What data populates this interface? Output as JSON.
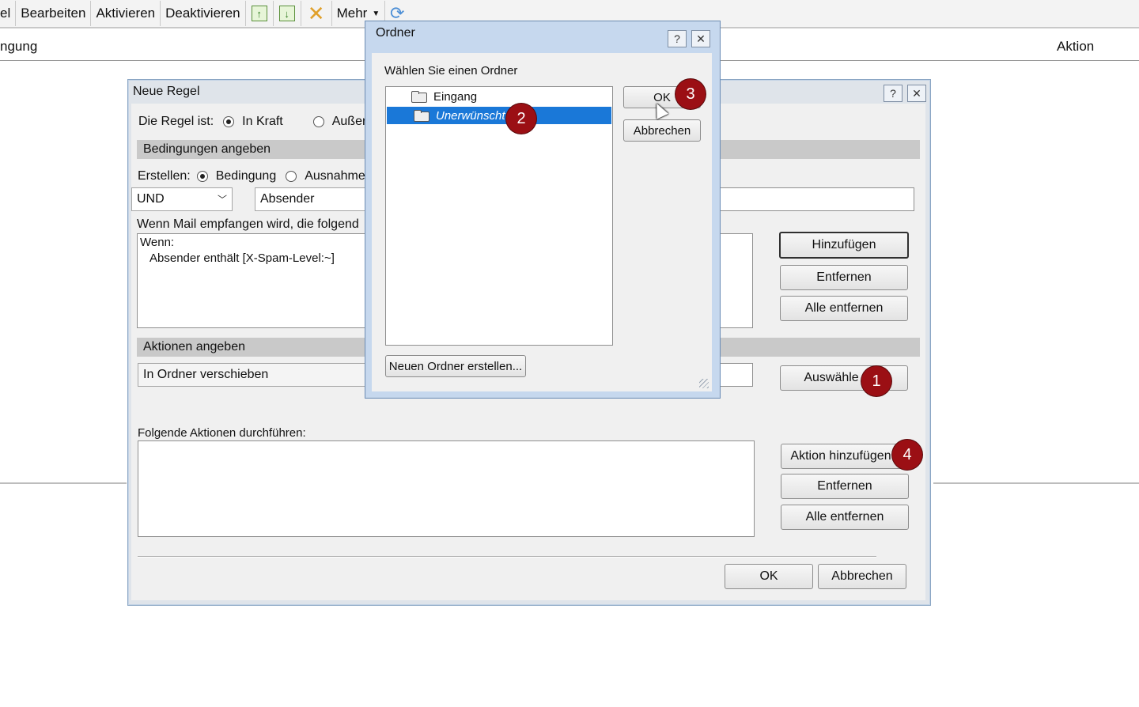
{
  "toolbar": {
    "items": [
      "el",
      "Bearbeiten",
      "Aktivieren",
      "Deaktivieren"
    ],
    "mehr": "Mehr"
  },
  "columns": {
    "left": "ngung",
    "right": "Aktion"
  },
  "rule_dialog": {
    "title": "Neue Regel",
    "rule_is_label": "Die Regel ist:",
    "in_force": "In Kraft",
    "out_of_force": "Außer",
    "conditions_header": "Bedingungen angeben",
    "create_label": "Erstellen:",
    "condition": "Bedingung",
    "exception": "Ausnahme",
    "operator_value": "UND",
    "field_value": "Absender",
    "when_received": "Wenn Mail empfangen wird, die folgend",
    "conditions_text_line1": "Wenn:",
    "conditions_text_line2": "Absender enthält [X-Spam-Level:~]",
    "btn_add": "Hinzufügen",
    "btn_remove": "Entfernen",
    "btn_remove_all": "Alle entfernen",
    "actions_header": "Aktionen angeben",
    "action_value": "In Ordner verschieben",
    "btn_select": "Auswähle",
    "perform_label": "Folgende Aktionen durchführen:",
    "btn_add_action": "Aktion hinzufügen",
    "btn_remove2": "Entfernen",
    "btn_remove_all2": "Alle entfernen",
    "btn_ok": "OK",
    "btn_cancel": "Abbrechen",
    "help": "?",
    "close": "✕"
  },
  "folder_dialog": {
    "title": "Ordner",
    "prompt": "Wählen Sie einen Ordner",
    "folders": [
      "Eingang",
      "Unerwünscht"
    ],
    "btn_ok": "OK",
    "btn_cancel": "Abbrechen",
    "btn_new_folder": "Neuen Ordner erstellen...",
    "help": "?",
    "close": "✕"
  },
  "badges": [
    "1",
    "2",
    "3",
    "4"
  ],
  "colors": {
    "badge": "#9b0f14",
    "selection": "#1a78d8"
  }
}
